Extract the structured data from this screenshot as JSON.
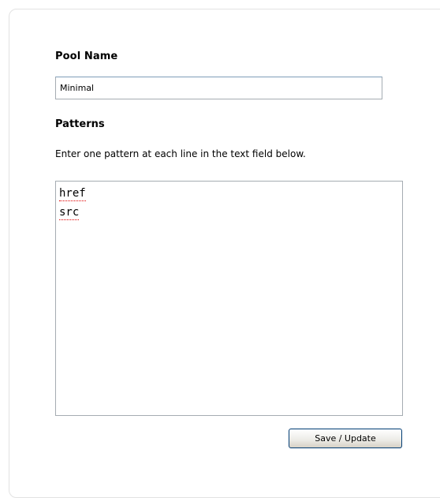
{
  "form": {
    "pool_name_label": "Pool Name",
    "pool_name_value": "Minimal",
    "patterns_label": "Patterns",
    "patterns_help": "Enter one pattern at each line in the text field below.",
    "patterns": [
      "href",
      "src"
    ],
    "save_label": "Save / Update"
  }
}
